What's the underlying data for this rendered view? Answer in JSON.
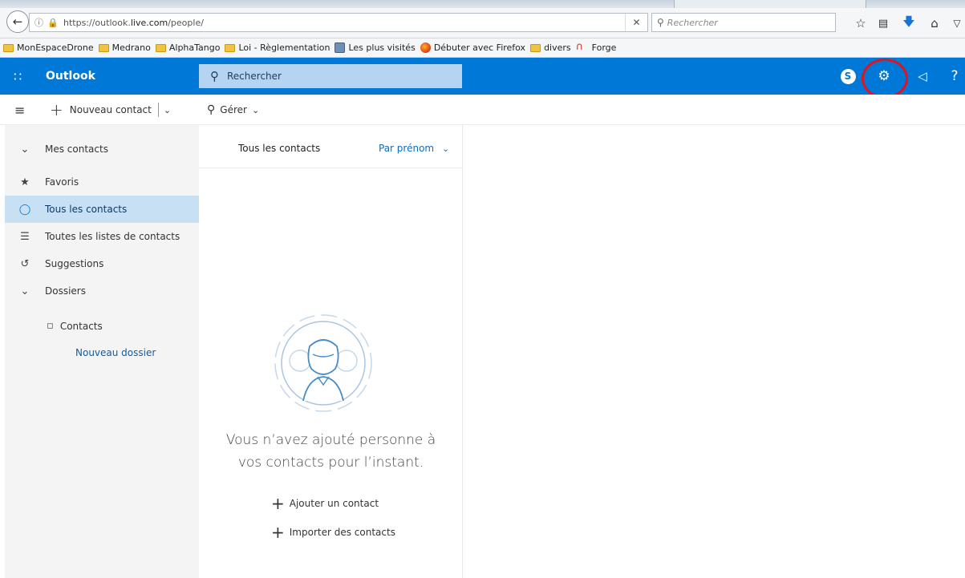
{
  "browser": {
    "url_prefix": "https://outlook.",
    "url_domain": "live.com",
    "url_path": "/people/",
    "search_placeholder": "Rechercher",
    "bookmarks": [
      {
        "label": "MonEspaceDrone",
        "icon": "folder-icon"
      },
      {
        "label": "Medrano",
        "icon": "folder-icon"
      },
      {
        "label": "AlphaTango",
        "icon": "folder-icon"
      },
      {
        "label": "Loi - Règlementation",
        "icon": "folder-icon"
      },
      {
        "label": "Les plus visités",
        "icon": "most-visited-icon"
      },
      {
        "label": "Débuter avec Firefox",
        "icon": "firefox-icon"
      },
      {
        "label": "divers",
        "icon": "folder-icon"
      },
      {
        "label": "Forge",
        "icon": "forge-icon"
      }
    ]
  },
  "app": {
    "brand": "Outlook",
    "search_label": "Rechercher",
    "accent": "#0078d7"
  },
  "commands": {
    "new_contact": "Nouveau contact",
    "manage": "Gérer"
  },
  "nav": {
    "my_contacts": "Mes contacts",
    "favorites": "Favoris",
    "all_contacts": "Tous les contacts",
    "all_lists": "Toutes les listes de contacts",
    "suggestions": "Suggestions",
    "folders": "Dossiers",
    "contacts_folder": "Contacts",
    "new_folder": "Nouveau dossier"
  },
  "list": {
    "title": "Tous les contacts",
    "sort": "Par prénom",
    "empty_line1": "Vous n’avez ajouté personne à",
    "empty_line2": "vos contacts pour l’instant.",
    "add_contact": "Ajouter un contact",
    "import_contacts": "Importer des contacts"
  }
}
